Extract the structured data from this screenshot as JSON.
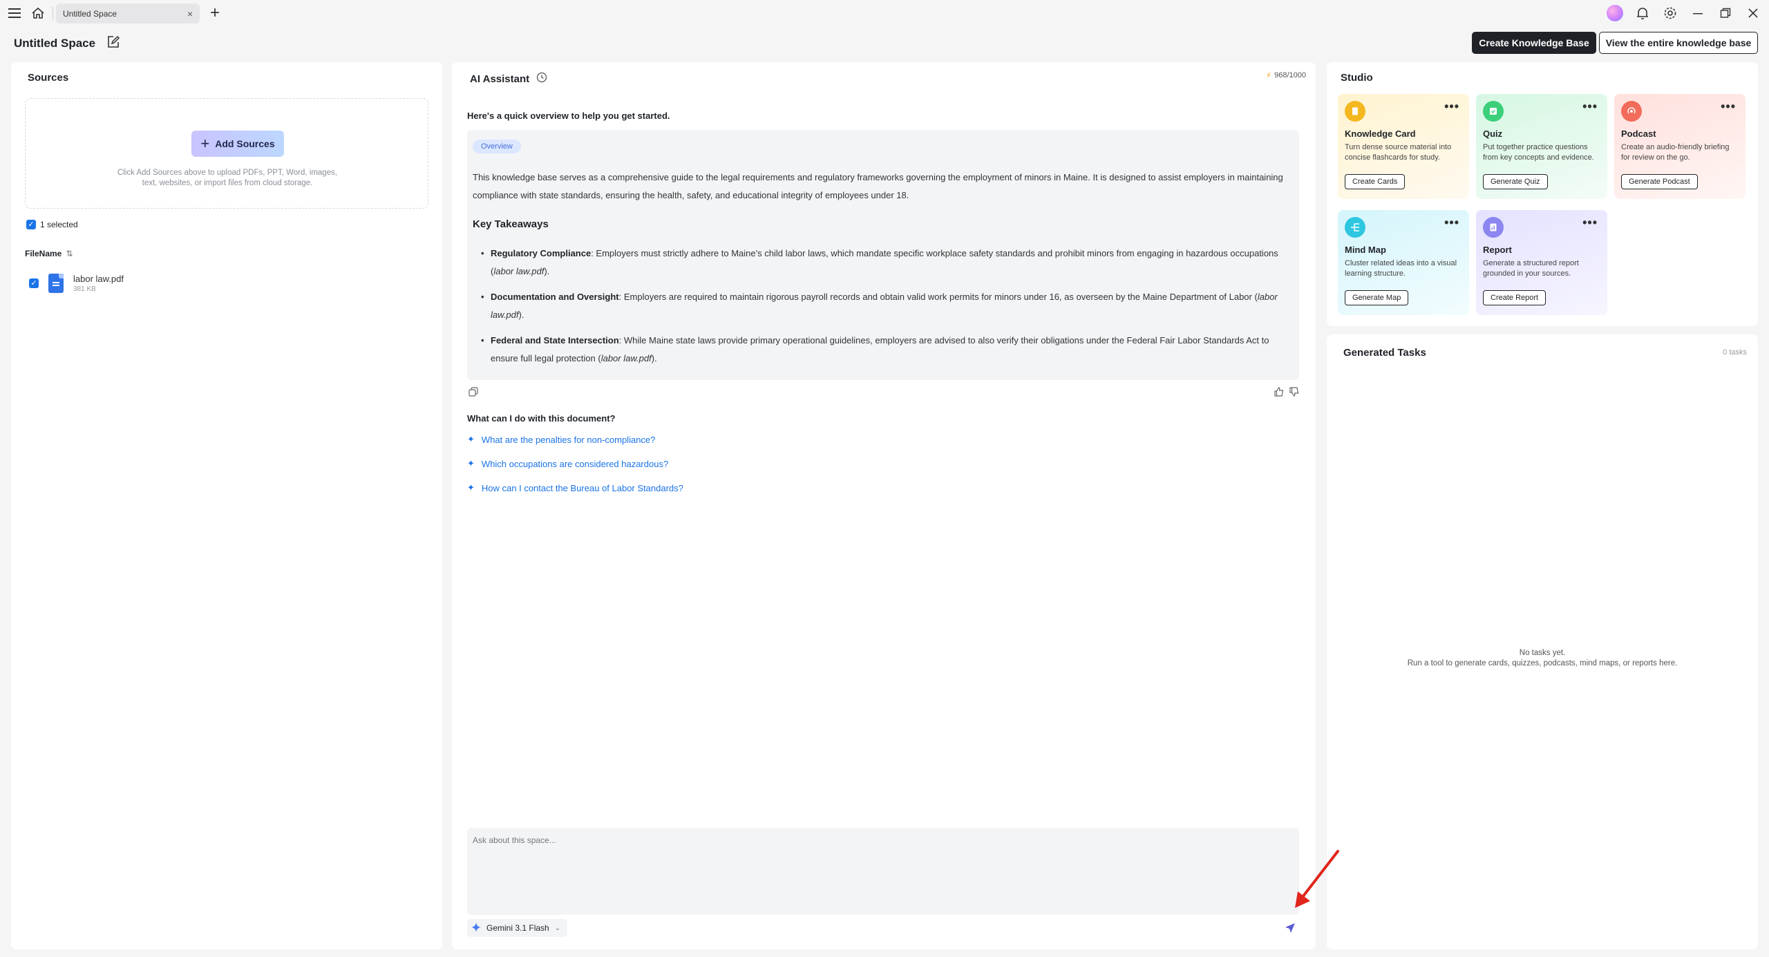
{
  "titlebar": {
    "tab_label": "Untitled Space",
    "tab_close": "×",
    "new_tab": "+",
    "icons": [
      "menu-icon",
      "home-icon",
      "avatar-icon",
      "bell-icon",
      "gear-icon",
      "minimize-icon",
      "restore-icon",
      "close-icon"
    ]
  },
  "space": {
    "title": "Untitled Space",
    "create_kb_label": "Create Knowledge Base",
    "view_kb_label": "View the entire knowledge base"
  },
  "sources": {
    "title": "Sources",
    "add_sources_label": "Add Sources",
    "drop_help_line1": "Click Add Sources above to upload PDFs, PPT, Word, images,",
    "drop_help_line2": "text, websites, or import files from cloud storage.",
    "selected_label": "1 selected",
    "filename_header": "FileName",
    "files": [
      {
        "name": "labor law.pdf",
        "size": "381 KB"
      }
    ]
  },
  "assistant": {
    "title": "AI Assistant",
    "credits": "968/1000",
    "intro": "Here's a quick overview to help you get started.",
    "overview_chip": "Overview",
    "overview_text": "This knowledge base serves as a comprehensive guide to the legal requirements and regulatory frameworks governing the employment of minors in Maine. It is designed to assist employers in maintaining compliance with state standards, ensuring the health, safety, and educational integrity of employees under 18.",
    "takeaways_title": "Key Takeaways",
    "takeaways": [
      {
        "head": "Regulatory Compliance",
        "body": ": Employers must strictly adhere to Maine's child labor laws, which mandate specific workplace safety standards and prohibit minors from engaging in hazardous occupations (",
        "cite": "labor law.pdf",
        "tail": ")."
      },
      {
        "head": "Documentation and Oversight",
        "body": ": Employers are required to maintain rigorous payroll records and obtain valid work permits for minors under 16, as overseen by the Maine Department of Labor (",
        "cite": "labor law.pdf",
        "tail": ")."
      },
      {
        "head": "Federal and State Intersection",
        "body": ": While Maine state laws provide primary operational guidelines, employers are advised to also verify their obligations under the Federal Fair Labor Standards Act to ensure full legal protection (",
        "cite": "labor law.pdf",
        "tail": ")."
      }
    ],
    "questions_title": "What can I do with this document?",
    "suggestions": [
      "What are the penalties for non-compliance?",
      "Which occupations are considered hazardous?",
      "How can I contact the Bureau of Labor Standards?"
    ],
    "chat_placeholder": "Ask about this space...",
    "model_label": "Gemini 3.1 Flash"
  },
  "studio": {
    "title": "Studio",
    "tools": [
      {
        "name": "Knowledge Card",
        "desc": "Turn dense source material into concise flashcards for study.",
        "button": "Create Cards",
        "icon": "card-icon",
        "color": "#f5b71f",
        "bg": "linear-gradient(160deg,#fff3cf,#fffaf0)"
      },
      {
        "name": "Quiz",
        "desc": "Put together practice questions from key concepts and evidence.",
        "button": "Generate Quiz",
        "icon": "quiz-icon",
        "color": "#3ccf7a",
        "bg": "linear-gradient(160deg,#d6f7e3,#f3fcf6)"
      },
      {
        "name": "Podcast",
        "desc": "Create an audio-friendly briefing for review on the go.",
        "button": "Generate Podcast",
        "icon": "podcast-icon",
        "color": "#f26b5b",
        "bg": "linear-gradient(160deg,#ffe0dc,#fff6f4)"
      },
      {
        "name": "Mind Map",
        "desc": "Cluster related ideas into a visual learning structure.",
        "button": "Generate Map",
        "icon": "mindmap-icon",
        "color": "#2fc6e0",
        "bg": "linear-gradient(160deg,#d4f5fb,#f2fcfe)"
      },
      {
        "name": "Report",
        "desc": "Generate a structured report grounded in your sources.",
        "button": "Create Report",
        "icon": "report-icon",
        "color": "#8b86f0",
        "bg": "linear-gradient(160deg,#e4e2ff,#f6f5ff)"
      }
    ],
    "more_label": "•••"
  },
  "tasks": {
    "title": "Generated Tasks",
    "count": "0 tasks",
    "empty_line1": "No tasks yet.",
    "empty_line2": "Run a tool to generate cards, quizzes, podcasts, mind maps, or reports here."
  }
}
